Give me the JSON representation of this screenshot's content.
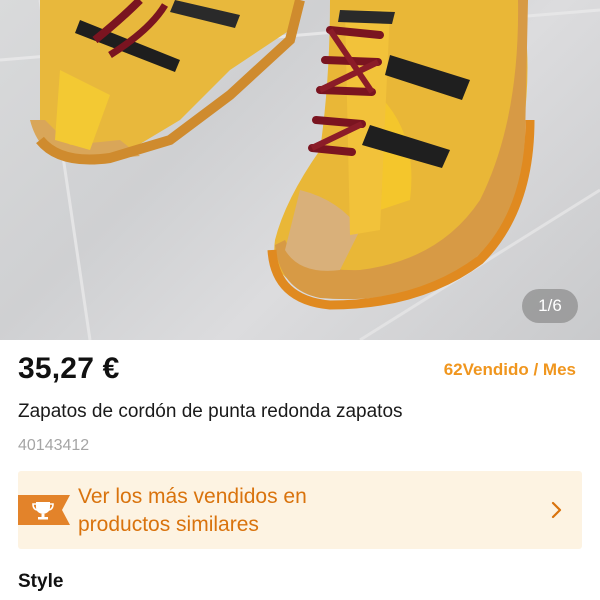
{
  "gallery": {
    "current": "1",
    "total": "6",
    "indicator": "1/6",
    "image_subject": "yellow suede sneakers with red laces and black stripes"
  },
  "product": {
    "price": "35,27 €",
    "sales_count": "62",
    "sales_label": "Vendido / Mes",
    "title": "Zapatos de cordón de punta redonda zapatos",
    "sku": "40143412"
  },
  "promo_banner": {
    "line1": "Ver los más vendidos en",
    "line2": "productos similares",
    "icon": "trophy-icon",
    "chevron_icon": "chevron-right-icon"
  },
  "sections": {
    "style_title": "Style"
  },
  "colors": {
    "accent_orange": "#f0961e",
    "banner_text": "#d9730d",
    "banner_bg": "#fdf3e2",
    "badge": "#e3832a"
  }
}
